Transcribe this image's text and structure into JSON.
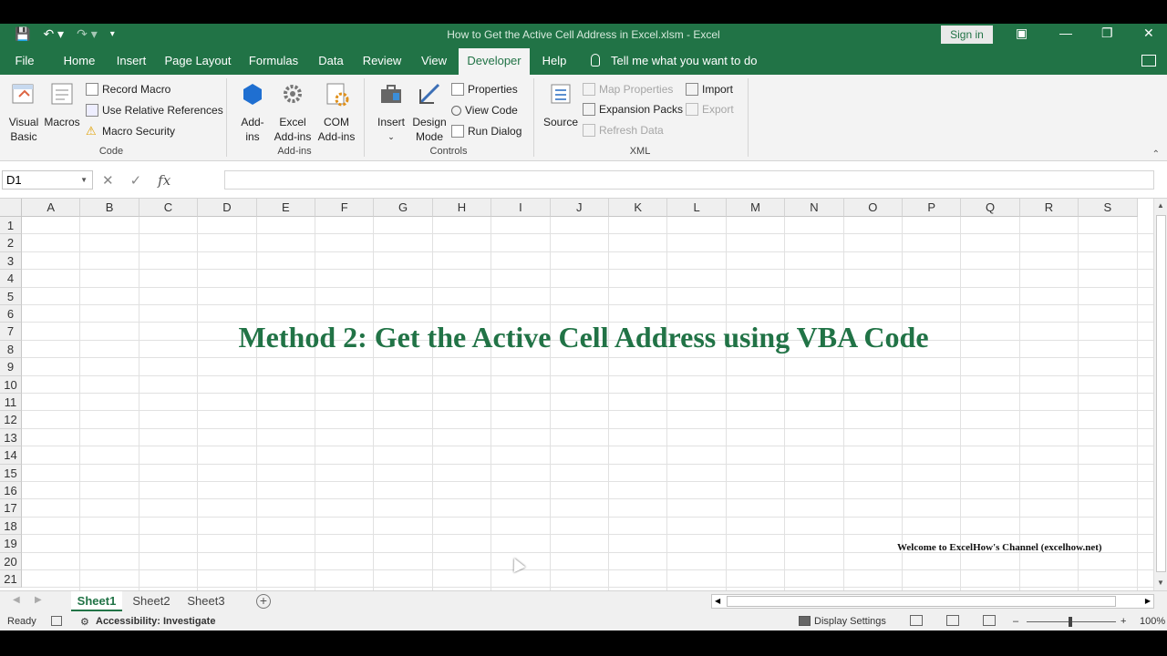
{
  "titlebar": {
    "title": "How to Get the Active Cell Address in Excel.xlsm  -  Excel",
    "sign_in": "Sign in",
    "save_icon": "save-icon",
    "undo_icon": "undo-icon",
    "redo_icon": "redo-icon"
  },
  "tabs": [
    "File",
    "Home",
    "Insert",
    "Page Layout",
    "Formulas",
    "Data",
    "Review",
    "View",
    "Developer",
    "Help"
  ],
  "active_tab": "Developer",
  "tell_me": "Tell me what you want to do",
  "ribbon": {
    "code": {
      "label": "Code",
      "visual_basic": [
        "Visual",
        "Basic"
      ],
      "macros": "Macros",
      "record_macro": "Record Macro",
      "relative_refs": "Use Relative References",
      "macro_security": "Macro Security"
    },
    "addins": {
      "label": "Add-ins",
      "addins": [
        "Add-",
        "ins"
      ],
      "excel_addins": [
        "Excel",
        "Add-ins"
      ],
      "com_addins": [
        "COM",
        "Add-ins"
      ]
    },
    "controls": {
      "label": "Controls",
      "insert": "Insert",
      "design_mode": [
        "Design",
        "Mode"
      ],
      "properties": "Properties",
      "view_code": "View Code",
      "run_dialog": "Run Dialog"
    },
    "xml": {
      "label": "XML",
      "source": "Source",
      "map_properties": "Map Properties",
      "expansion_packs": "Expansion Packs",
      "refresh_data": "Refresh Data",
      "import": "Import",
      "export": "Export"
    }
  },
  "formula_bar": {
    "name_box": "D1",
    "formula": "",
    "fx": "fx"
  },
  "columns": [
    "A",
    "B",
    "C",
    "D",
    "E",
    "F",
    "G",
    "H",
    "I",
    "J",
    "K",
    "L",
    "M",
    "N",
    "O",
    "P",
    "Q",
    "R",
    "S"
  ],
  "rows": [
    "1",
    "2",
    "3",
    "4",
    "5",
    "6",
    "7",
    "8",
    "9",
    "10",
    "11",
    "12",
    "13",
    "14",
    "15",
    "16",
    "17",
    "18",
    "19",
    "20",
    "21"
  ],
  "content": {
    "heading": "Method 2: Get the Active Cell Address using VBA Code",
    "welcome": "Welcome to ExcelHow's  Channel (excelhow.net)"
  },
  "sheets": [
    "Sheet1",
    "Sheet2",
    "Sheet3"
  ],
  "active_sheet": "Sheet1",
  "status": {
    "ready": "Ready",
    "accessibility": "Accessibility: Investigate",
    "display_settings": "Display Settings",
    "zoom": "100%"
  },
  "colors": {
    "accent": "#217346",
    "heading": "#217346"
  }
}
